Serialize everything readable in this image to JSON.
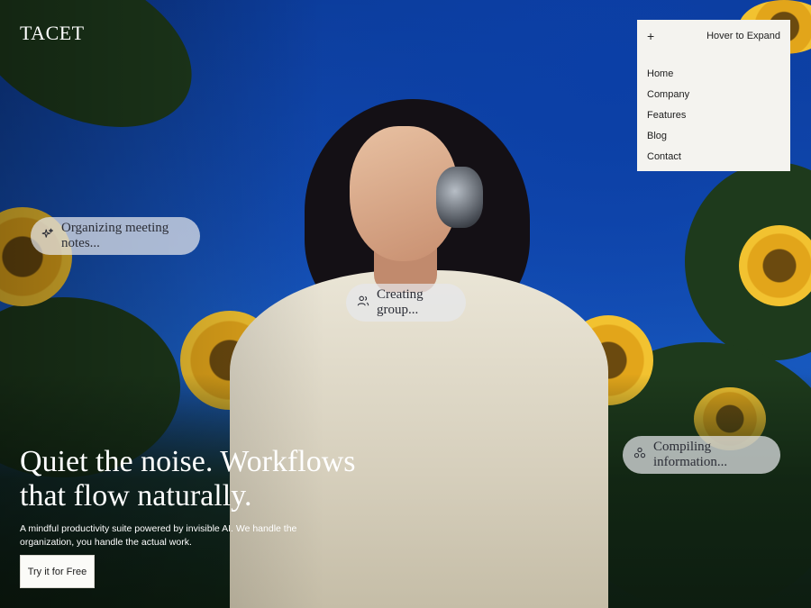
{
  "brand": {
    "name": "TACET"
  },
  "menu": {
    "toggle_icon": "plus-icon",
    "hint": "Hover to Expand",
    "items": [
      {
        "label": "Home"
      },
      {
        "label": "Company"
      },
      {
        "label": "Features"
      },
      {
        "label": "Blog"
      },
      {
        "label": "Contact"
      }
    ]
  },
  "chips": [
    {
      "icon": "sparkles-icon",
      "label": "Organizing meeting notes..."
    },
    {
      "icon": "users-icon",
      "label": "Creating group..."
    },
    {
      "icon": "nodes-icon",
      "label": "Compiling information..."
    }
  ],
  "hero": {
    "headline": "Quiet the noise. Workflows that flow naturally.",
    "subtext": "A mindful productivity suite powered by invisible AI. We handle the organization, you handle the actual work.",
    "cta_label": "Try it for Free"
  },
  "colors": {
    "sky": "#0d3c98",
    "menu_bg": "#f4f3ef",
    "chip_bg": "#e6e8ec",
    "text_on_dark": "#ffffff"
  }
}
